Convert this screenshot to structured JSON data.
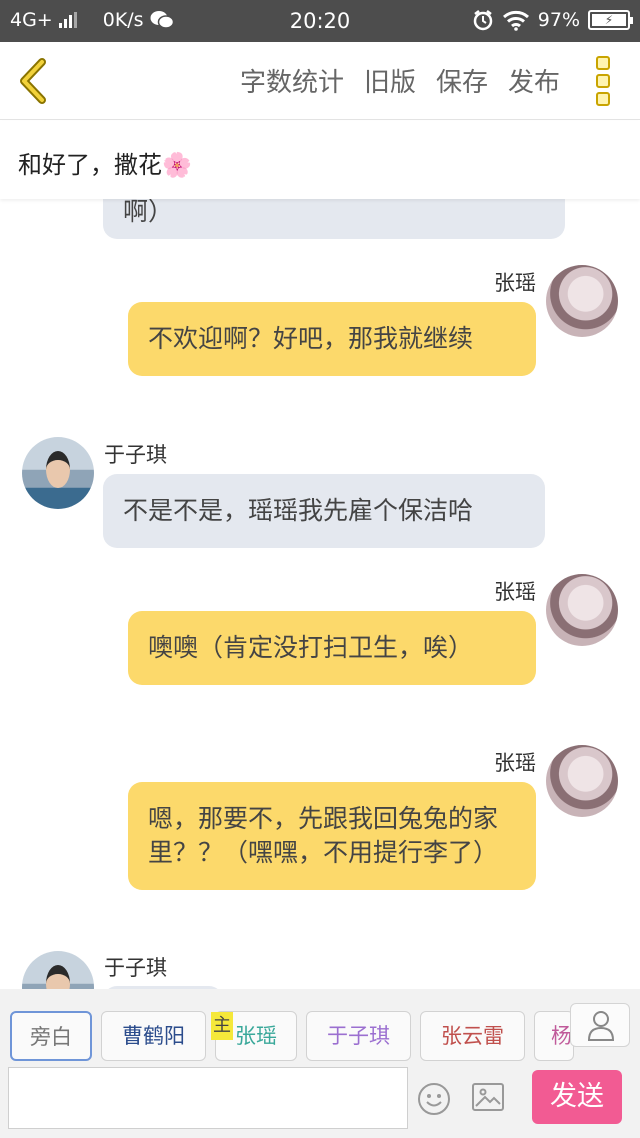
{
  "status_bar": {
    "network": "4G+",
    "speed": "0K/s",
    "time": "20:20",
    "battery": "97%"
  },
  "header": {
    "actions": [
      "字数统计",
      "旧版",
      "保存",
      "发布"
    ]
  },
  "title": "和好了，撒花🌸",
  "messages": [
    {
      "side": "left",
      "text": "啊）"
    },
    {
      "side": "right",
      "sender": "张瑶",
      "text": "不欢迎啊？好吧，那我就继续"
    },
    {
      "side": "left",
      "sender": "于子琪",
      "text": "不是不是，瑶瑶我先雇个保洁哈"
    },
    {
      "side": "right",
      "sender": "张瑶",
      "text": "噢噢（肯定没打扫卫生，唉）"
    },
    {
      "side": "right",
      "sender": "张瑶",
      "text": "嗯，那要不，先跟我回兔兔的家里？？（嘿嘿，不用提行李了）"
    },
    {
      "side": "left",
      "sender": "于子琪",
      "text": ""
    }
  ],
  "roles": [
    {
      "label": "旁白",
      "color": "#777777"
    },
    {
      "label": "曹鹤阳",
      "color": "#2b4c8c"
    },
    {
      "label": "张瑶",
      "color": "#3aa89a"
    },
    {
      "label": "于子琪",
      "color": "#9b6fd0"
    },
    {
      "label": "张云雷",
      "color": "#c0504d"
    },
    {
      "label": "杨",
      "color": "#c05a9a"
    }
  ],
  "host_badge": "主",
  "send_label": "发送",
  "colors": {
    "accent": "#f25b93",
    "bubble_right": "#fcd96b",
    "bubble_left": "#e4e8ef"
  }
}
